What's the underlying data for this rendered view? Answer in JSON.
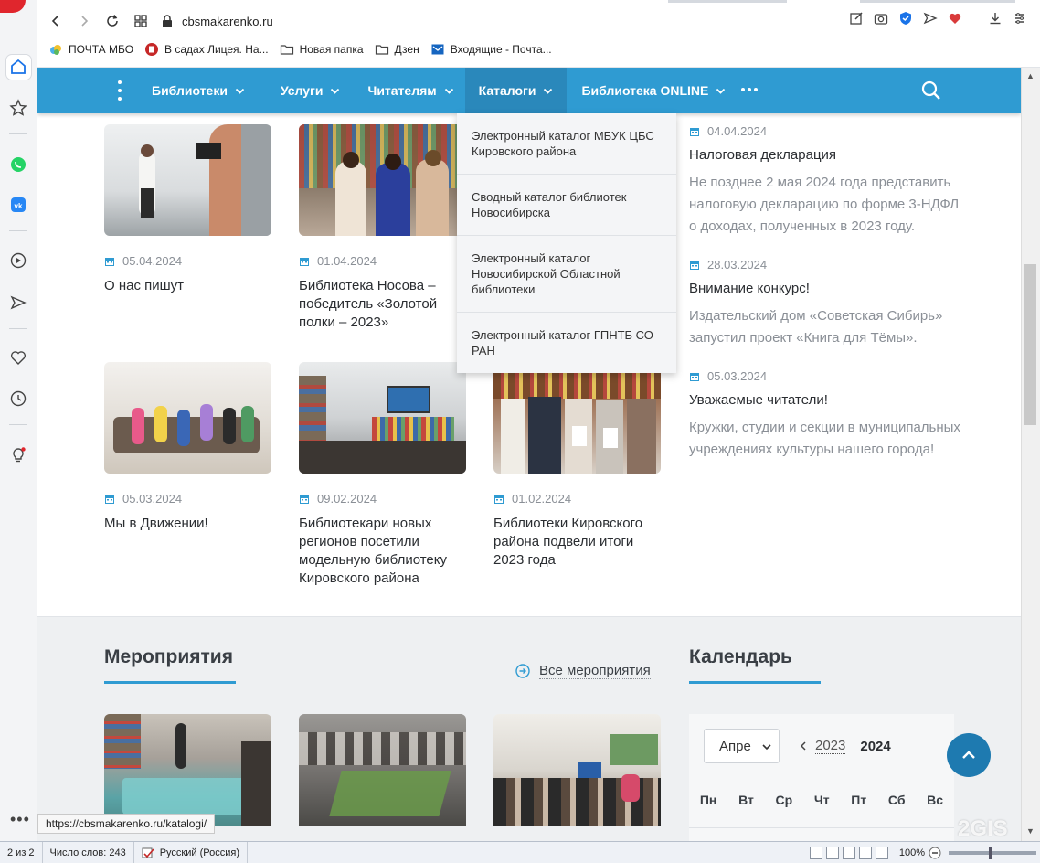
{
  "browser": {
    "url": "cbsmakarenko.ru",
    "bookmarks": [
      {
        "label": "ПОЧТА МБО",
        "icon": "mail-cloud-icon"
      },
      {
        "label": "В садах Лицея. На...",
        "icon": "red-book-icon"
      },
      {
        "label": "Новая папка",
        "icon": "folder-icon"
      },
      {
        "label": "Дзен",
        "icon": "folder-icon"
      },
      {
        "label": "Входящие - Почта...",
        "icon": "outlook-mail-icon"
      }
    ],
    "status_url": "https://cbsmakarenko.ru/katalogi/"
  },
  "nav": {
    "items": [
      {
        "label": "Библиотеки"
      },
      {
        "label": "Услуги"
      },
      {
        "label": "Читателям"
      },
      {
        "label": "Каталоги",
        "active": true
      },
      {
        "label": "Библиотека ONLINE"
      }
    ],
    "dropdown": [
      "Электронный каталог МБУК ЦБС Кировского района",
      "Сводный каталог библиотек Новосибирска",
      "Электронный каталог Новосибирской Областной библиотеки",
      "Электронный каталог ГПНТБ СО РАН"
    ]
  },
  "news": [
    {
      "date": "05.04.2024",
      "title": "О нас пишут"
    },
    {
      "date": "01.04.2024",
      "title": "Библиотека Носова – победитель «Золотой полки – 2023»"
    },
    {
      "date": "05.03.2024",
      "title": "Мы в Движении!"
    },
    {
      "date": "09.02.2024",
      "title": "Библиотекари новых регионов посетили модельную библиотеку Кировского района"
    },
    {
      "date": "01.02.2024",
      "title": "Библиотеки Кировского района подвели итоги 2023 года"
    }
  ],
  "side_news": [
    {
      "date": "04.04.2024",
      "title": "Налоговая декларация",
      "text": "Не позднее 2 мая 2024 года представить налоговую декларацию по форме 3-НДФЛ о доходах, полученных в 2023 году."
    },
    {
      "date": "28.03.2024",
      "title": "Внимание конкурс!",
      "text": "Издательский дом «Советская Сибирь» запустил проект «Книга для Тёмы»."
    },
    {
      "date": "05.03.2024",
      "title": "Уважаемые читатели!",
      "text": "Кружки, студии и секции в муниципальных учреждениях культуры нашего города!"
    }
  ],
  "events": {
    "title": "Мероприятия",
    "all_label": "Все мероприятия"
  },
  "calendar": {
    "title": "Календарь",
    "month": "Апре",
    "prev_year": "2023",
    "year": "2024",
    "weekdays": [
      "Пн",
      "Вт",
      "Ср",
      "Чт",
      "Пт",
      "Сб",
      "Вс"
    ]
  },
  "word_status": {
    "page": "2 из 2",
    "words": "Число слов: 243",
    "lang": "Русский (Россия)",
    "zoom": "100%"
  },
  "watermark": "2GIS",
  "colors": {
    "accent": "#2f9bd2",
    "accent_dark": "#1e7ab0",
    "brand_red": "#e0262d"
  }
}
